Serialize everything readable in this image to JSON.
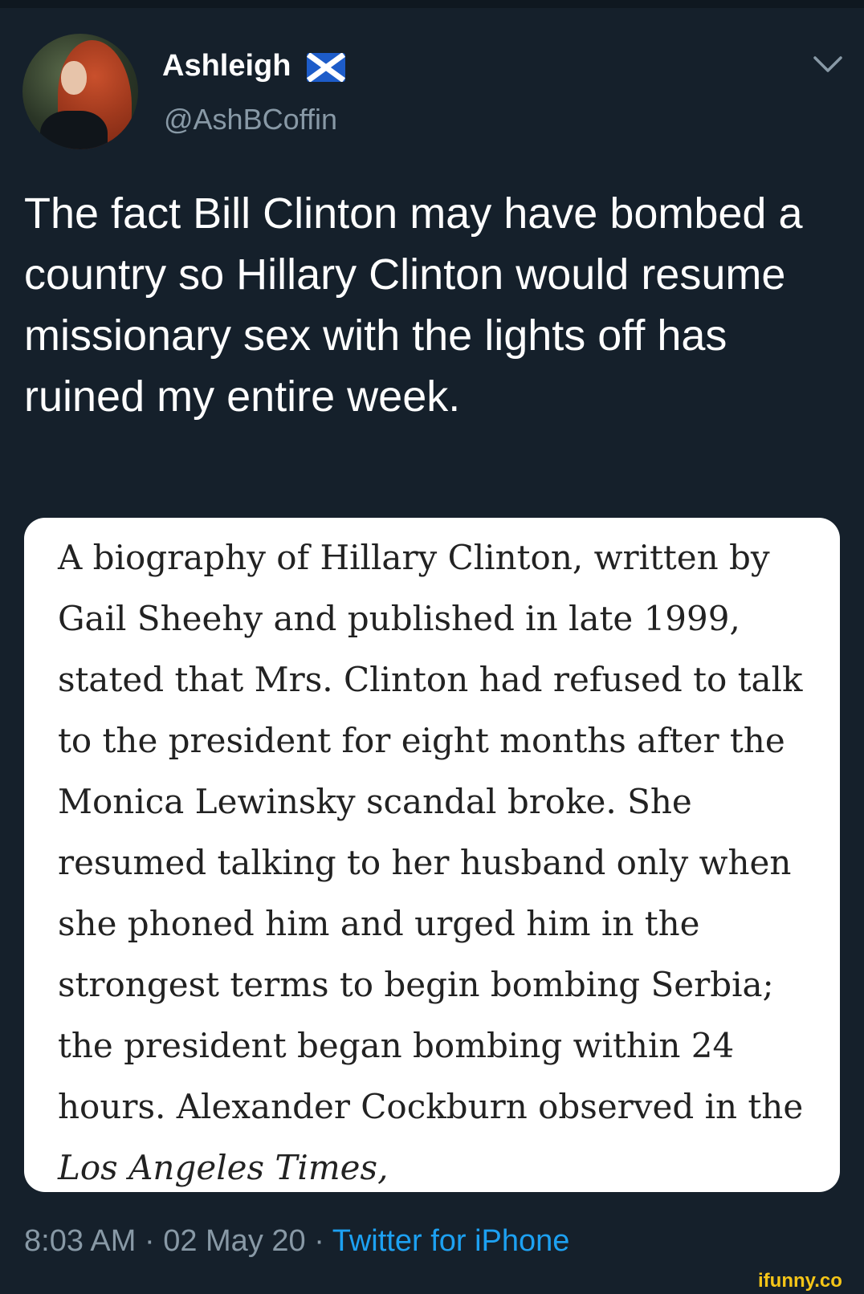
{
  "tweet": {
    "display_name": "Ashleigh",
    "flag_icon": "scotland-flag-icon",
    "handle": "@AshBCoffin",
    "text": "The fact Bill Clinton may have bombed a country so Hillary Clinton would resume missionary sex with the lights off has ruined my entire week.",
    "media_text": "A biography of Hillary Clinton, written by Gail Sheehy and published in late 1999, stated that Mrs. Clinton had refused to talk to the president for eight months after the Monica Lewinsky scandal broke. She resumed talking to her husband only when she phoned him and urged him in the strongest terms to begin bombing Serbia; the president began bombing within 24 hours. Alexander Cockburn observed in the",
    "media_text_italic": "Los Angeles Times,",
    "time": "8:03 AM",
    "date": "02 May 20",
    "separator": "·",
    "source": "Twitter for iPhone"
  },
  "watermark": "ifunny.co",
  "colors": {
    "background": "#15202b",
    "text": "#ffffff",
    "secondary_text": "#8899a6",
    "link": "#1da1f2",
    "flag_blue": "#1d5cc9"
  }
}
